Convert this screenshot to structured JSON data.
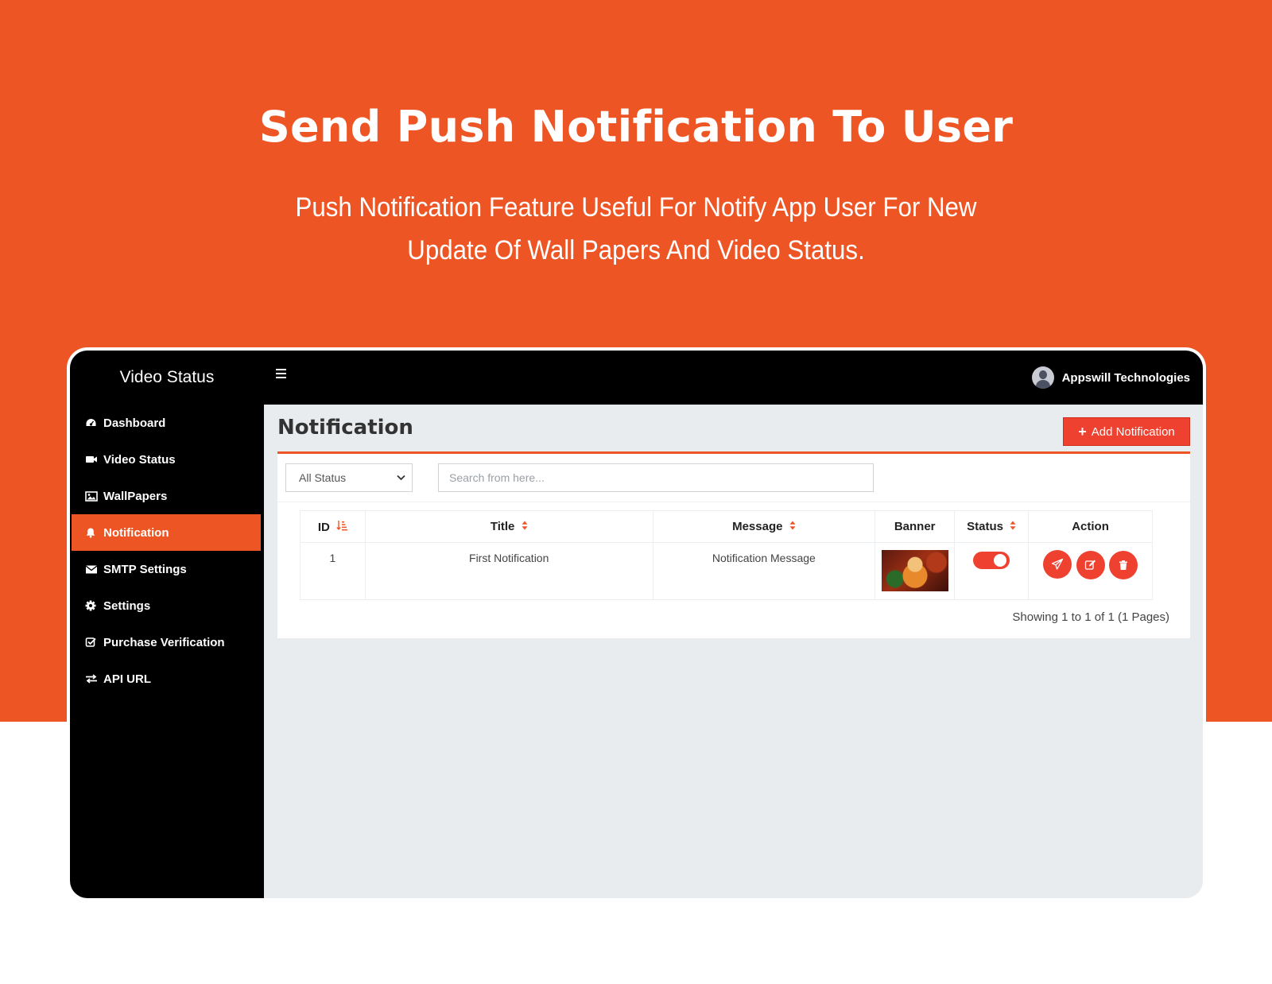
{
  "hero": {
    "title": "Send Push Notification To User",
    "subtitle": "Push Notification Feature Useful For Notify App User For New Update Of Wall Papers And Video Status."
  },
  "app": {
    "brand": "Video Status",
    "menu_icon": "hamburger-icon",
    "user_name": "Appswill Technologies",
    "accent_color": "#ee5524"
  },
  "sidebar": {
    "items": [
      {
        "label": "Dashboard",
        "icon": "dashboard-icon"
      },
      {
        "label": "Video Status",
        "icon": "video-icon"
      },
      {
        "label": "WallPapers",
        "icon": "image-icon"
      },
      {
        "label": "Notification",
        "icon": "bell-icon",
        "active": true
      },
      {
        "label": "SMTP Settings",
        "icon": "envelope-icon"
      },
      {
        "label": "Settings",
        "icon": "gear-icon"
      },
      {
        "label": "Purchase Verification",
        "icon": "check-square-icon"
      },
      {
        "label": "API URL",
        "icon": "exchange-icon"
      }
    ]
  },
  "page": {
    "title": "Notification",
    "add_button": "Add Notification",
    "filter_value": "All Status",
    "search_placeholder": "Search from here..."
  },
  "table": {
    "columns": [
      "ID",
      "Title",
      "Message",
      "Banner",
      "Status",
      "Action"
    ],
    "rows": [
      {
        "id": "1",
        "title": "First Notification",
        "message": "Notification Message",
        "banner": "banner-image",
        "status": true
      }
    ],
    "showing": "Showing 1 to 1 of 1 (1 Pages)"
  }
}
